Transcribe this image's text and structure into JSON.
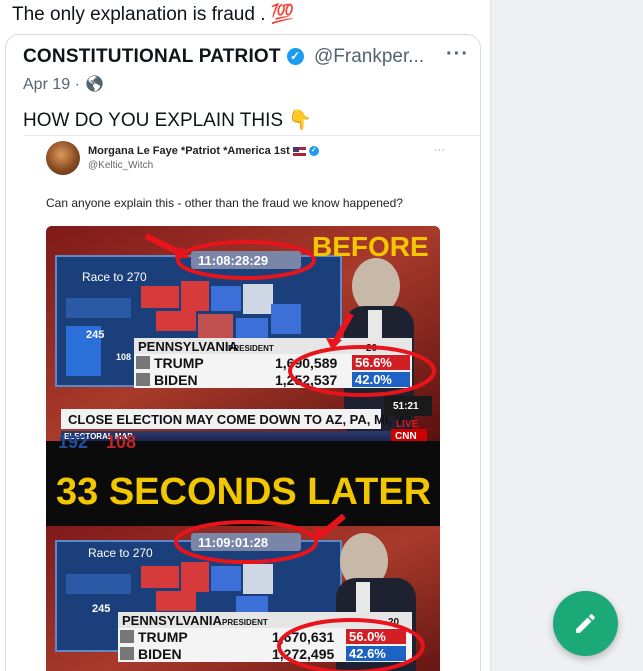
{
  "post": {
    "text": "The only explanation is fraud . 💯"
  },
  "quote": {
    "author_name": "CONSTITUTIONAL PATRIOT",
    "handle": "@Frankper...",
    "date": "Apr 19 · ",
    "text": "HOW DO YOU EXPLAIN THIS 👇"
  },
  "inner_tweet": {
    "author_name": "Morgana Le Faye *Patriot *America 1st",
    "handle": "@Keltic_Witch",
    "text": "Can anyone explain this - other than the fraud we know happened?"
  },
  "image": {
    "before_label": "BEFORE",
    "clock_before": "11:08:28:29",
    "clock_after": "11:09:01:28",
    "race_label": "Race to 270",
    "ev_245": "245",
    "ev_108": "108",
    "state_label": "PENNSYLVANIA",
    "president_label": "PRESIDENT",
    "pct_in": "20",
    "trump_label": "TRUMP",
    "biden_label": "BIDEN",
    "before": {
      "trump_votes": "1,690,589",
      "trump_pct": "56.6%",
      "biden_votes": "1,252,537",
      "biden_pct": "42.0%"
    },
    "after": {
      "trump_votes": "1,670,631",
      "trump_pct": "56.0%",
      "biden_votes": "1,272,495",
      "biden_pct": "42.6%"
    },
    "ticker": "CLOSE ELECTION MAY COME DOWN TO AZ, PA, MI, WI",
    "time_box": "51:21",
    "live_label": "LIVE",
    "network": "CNN",
    "electoral_map": "ELECTORAL MAP",
    "ev_192": "192",
    "ev_108b": "108",
    "middle_banner": "33 SECONDS LATER"
  },
  "colors": {
    "fab": "#1aa977",
    "verified": "#1d9bf0",
    "trump_red": "#d21f26",
    "biden_blue": "#1d63c4"
  }
}
